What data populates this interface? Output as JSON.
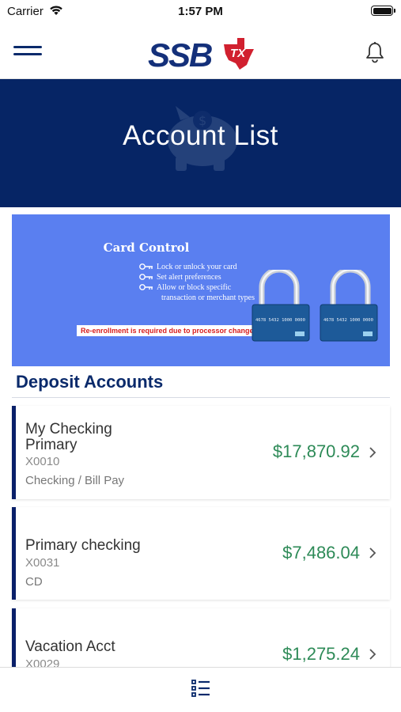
{
  "status_bar": {
    "carrier": "Carrier",
    "time": "1:57 PM"
  },
  "header": {
    "logo_text": "SSB",
    "logo_suffix": "TX"
  },
  "hero": {
    "title": "Account List"
  },
  "banner": {
    "title": "Card Control",
    "items": [
      "Lock or unlock your card",
      "Set alert preferences",
      "Allow or block specific",
      "transaction or merchant types"
    ],
    "notice": "Re-enrollment is required due to processor change.",
    "card_number": "4678 5432 1000 0000",
    "colors": {
      "background": "#5a7ff0",
      "notice": "#d81d1d"
    }
  },
  "deposit_section": {
    "title": "Deposit Accounts"
  },
  "accounts": [
    {
      "name": "My Checking Primary",
      "number": "X0010",
      "type": "Checking / Bill Pay",
      "balance": "$17,870.92"
    },
    {
      "name": "Primary checking",
      "number": "X0031",
      "type": "CD",
      "balance": "$7,486.04"
    },
    {
      "name": "Vacation Acct",
      "number": "X0029",
      "type": "",
      "balance": "$1,275.24"
    }
  ],
  "icons": {
    "menu": "hamburger-icon",
    "notifications": "bell-icon",
    "hero": "piggy-bank-icon",
    "row": "chevron-right-icon",
    "bottom": "list-icon"
  },
  "colors": {
    "brand_navy": "#062565",
    "balance_green": "#2d8a57",
    "logo_red": "#d1202f"
  }
}
